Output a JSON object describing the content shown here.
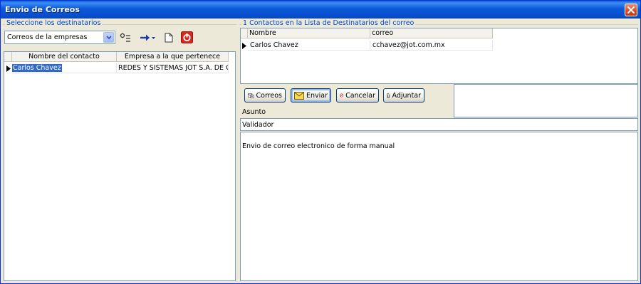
{
  "window": {
    "title": "Envio de Correos"
  },
  "left": {
    "group_label": "Seleccione los destinatarios",
    "combo_value": "Correos de la empresas",
    "grid": {
      "headers": [
        "Nombre del contacto",
        "Empresa a la que pertenece"
      ],
      "rows": [
        {
          "contacto": "Carlos Chavez",
          "empresa": "REDES Y SISTEMAS JOT S.A. DE C.V."
        }
      ]
    }
  },
  "right": {
    "group_label": "1 Contactos en la  Lista de Destinatarios del correo",
    "grid": {
      "headers": [
        "Nombre",
        "correo"
      ],
      "rows": [
        {
          "nombre": "Carlos Chavez",
          "correo": "cchavez@jot.com.mx"
        }
      ]
    },
    "buttons": {
      "correos": "Correos",
      "enviar": "Enviar",
      "cancelar": "Cancelar",
      "adjuntar": "Adjuntar"
    },
    "asunto_label": "Asunto",
    "asunto_value": "Validador",
    "body_text": "Envio de correo electronico de forma manual"
  }
}
